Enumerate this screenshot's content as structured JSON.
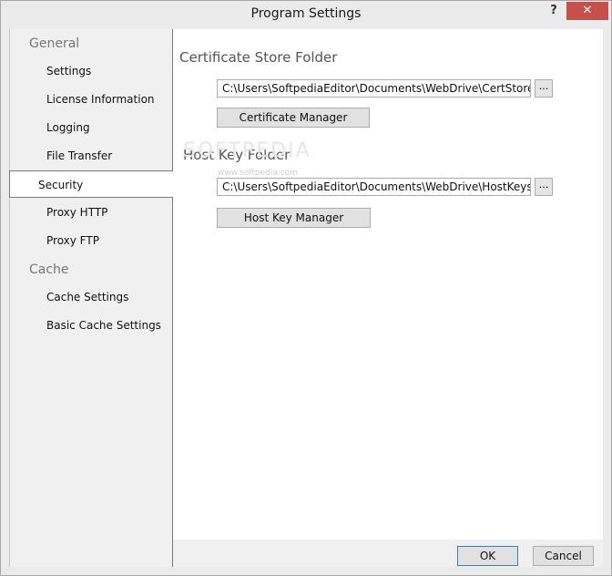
{
  "window": {
    "title": "Program Settings",
    "help_label": "?",
    "close_label": "✕"
  },
  "sidebar": {
    "groups": [
      {
        "label": "General",
        "items": [
          "Settings",
          "License Information",
          "Logging",
          "File Transfer",
          "Security",
          "Proxy HTTP",
          "Proxy FTP"
        ]
      },
      {
        "label": "Cache",
        "items": [
          "Cache Settings",
          "Basic Cache Settings"
        ]
      }
    ],
    "selected": "Security"
  },
  "content": {
    "cert_section": {
      "heading": "Certificate Store Folder",
      "path": "C:\\Users\\SoftpediaEditor\\Documents\\WebDrive\\CertStore",
      "browse_label": "...",
      "manager_label": "Certificate Manager"
    },
    "hostkey_section": {
      "heading": "Host Key Folder",
      "path": "C:\\Users\\SoftpediaEditor\\Documents\\WebDrive\\HostKeys",
      "browse_label": "...",
      "manager_label": "Host Key Manager"
    },
    "watermark": "SOFTPEDIA",
    "watermark_url": "www.softpedia.com"
  },
  "footer": {
    "ok_label": "OK",
    "cancel_label": "Cancel"
  },
  "colors": {
    "close_button": "#c7504b",
    "ok_border": "#3c7fb1"
  }
}
